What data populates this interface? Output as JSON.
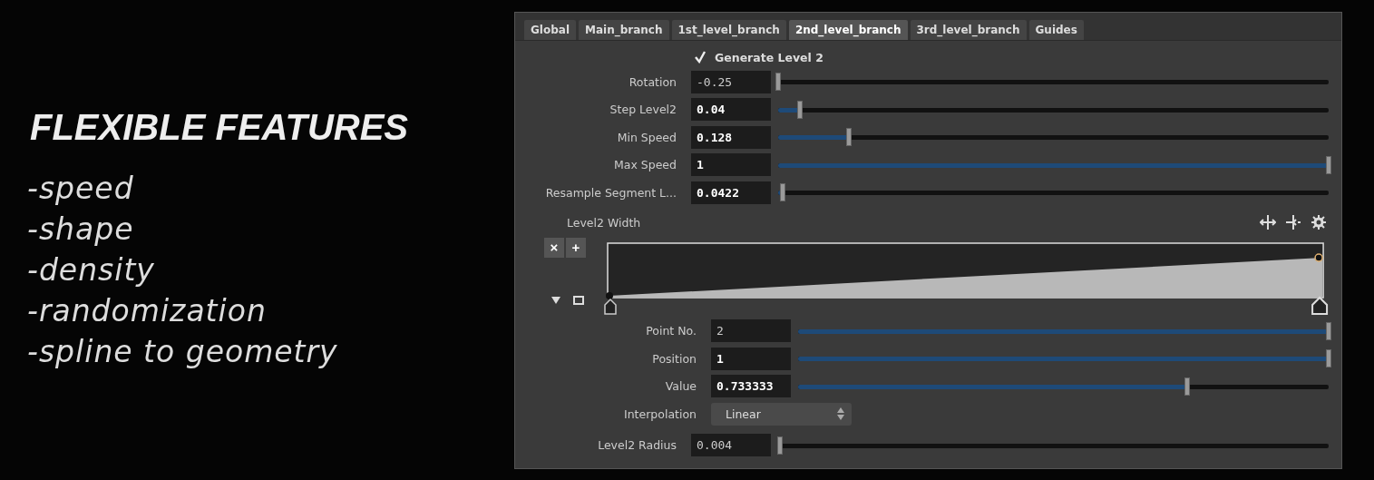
{
  "promo": {
    "title": "FLEXIBLE FEATURES",
    "features": [
      "-speed",
      "-shape",
      "-density",
      "-randomization",
      "-spline to geometry"
    ]
  },
  "tabs": [
    {
      "label": "Global",
      "selected": false
    },
    {
      "label": "Main_branch",
      "selected": false
    },
    {
      "label": "1st_level_branch",
      "selected": false
    },
    {
      "label": "2nd_level_branch",
      "selected": true
    },
    {
      "label": "3rd_level_branch",
      "selected": false
    },
    {
      "label": "Guides",
      "selected": false
    }
  ],
  "generate": {
    "label": "Generate Level 2",
    "checked": true
  },
  "params": [
    {
      "label": "Rotation",
      "value": "-0.25",
      "changed": false,
      "level": 0
    },
    {
      "label": "Step Level2",
      "value": "0.04",
      "changed": true,
      "level": 0.04
    },
    {
      "label": "Min Speed",
      "value": "0.128",
      "changed": true,
      "level": 0.128
    },
    {
      "label": "Max Speed",
      "value": "1",
      "changed": true,
      "level": 1
    },
    {
      "label": "Resample Segment L...",
      "value": "0.0422",
      "changed": true,
      "level": 0.008
    }
  ],
  "ramp": {
    "label": "Level2 Width",
    "delete_button": "×",
    "add_button": "+",
    "point_params": [
      {
        "label": "Point No.",
        "value": "2",
        "changed": false,
        "level": 1
      },
      {
        "label": "Position",
        "value": "1",
        "changed": true,
        "level": 1
      },
      {
        "label": "Value",
        "value": "0.733333",
        "changed": true,
        "level": 0.733
      }
    ],
    "interpolation": {
      "label": "Interpolation",
      "value": "Linear"
    }
  },
  "radius": {
    "label": "Level2 Radius",
    "value": "0.004",
    "changed": false,
    "level": 0.004
  }
}
